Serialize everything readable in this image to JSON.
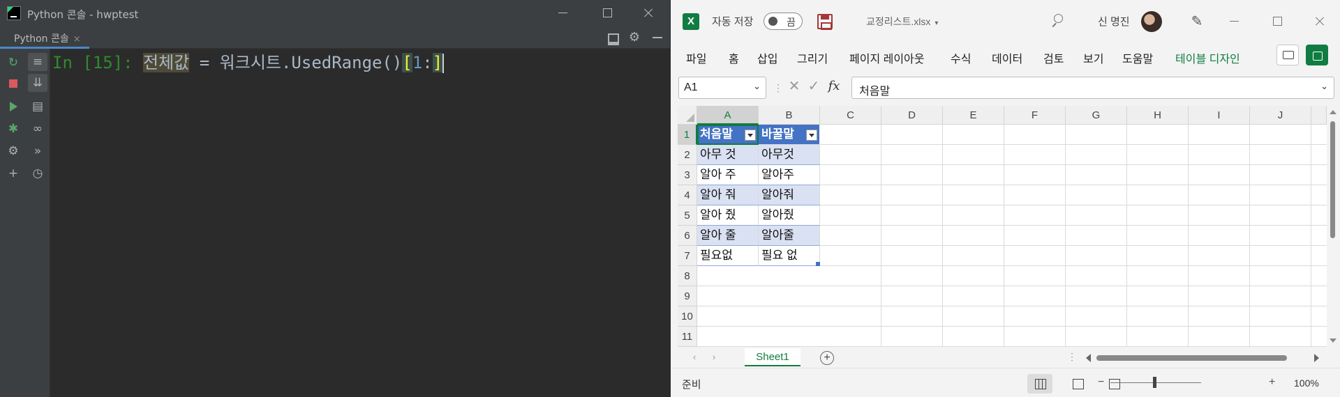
{
  "pycharm": {
    "window_title": "Python 콘솔 - hwptest",
    "tab_label": "Python 콘솔",
    "tab_close": "×",
    "console": {
      "prompt": "In [15]: ",
      "variable": "전체값",
      "op": " = ",
      "call": "워크시트.UsedRange()",
      "open_bracket": "[",
      "index": "1",
      "colon": ":",
      "close_bracket": "]"
    }
  },
  "excel": {
    "logo": "X",
    "autosave_label": "자동 저장",
    "autosave_state": "끔",
    "filename": "교정리스트.xlsx",
    "filename_dropdown": "▾",
    "user_name": "신 명진",
    "ribbon_tabs": [
      "파일",
      "홈",
      "삽입",
      "그리기",
      "페이지 레이아웃",
      "수식",
      "데이터",
      "검토",
      "보기",
      "도움말",
      "테이블 디자인"
    ],
    "name_box": "A1",
    "formula_separator": "⋮",
    "fx_label": "fx",
    "formula_value": "처음말",
    "column_headers": [
      "A",
      "B",
      "C",
      "D",
      "E",
      "F",
      "G",
      "H",
      "I",
      "J"
    ],
    "row_headers": [
      "1",
      "2",
      "3",
      "4",
      "5",
      "6",
      "7",
      "8",
      "9",
      "10",
      "11"
    ],
    "table": {
      "header": [
        "처음말",
        "바꿀말"
      ],
      "rows": [
        [
          "아무 것",
          "아무것"
        ],
        [
          "알아 주",
          "알아주"
        ],
        [
          "알아 줘",
          "알아줘"
        ],
        [
          "알아 줬",
          "알아줬"
        ],
        [
          "알아 줄",
          "알아줄"
        ],
        [
          "필요없",
          "필요 없"
        ]
      ]
    },
    "sheet_tab": "Sheet1",
    "add_sheet": "+",
    "status": "준비",
    "zoom_minus": "−",
    "zoom_plus": "+",
    "zoom": "100%",
    "colors": {
      "accent": "#107c41",
      "table_header": "#4472c4",
      "table_band": "#d9e1f2"
    }
  }
}
